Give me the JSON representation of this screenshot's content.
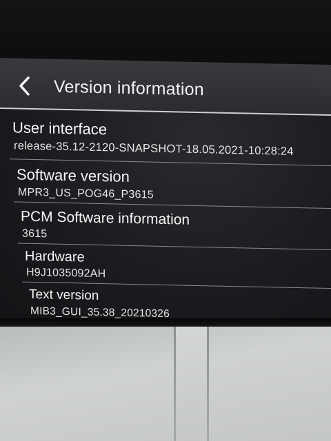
{
  "header": {
    "title": "Version information",
    "back_icon": "chevron-left-icon"
  },
  "items": [
    {
      "label": "User interface",
      "value": "release-35.12-2120-SNAPSHOT-18.05.2021-10:28:24"
    },
    {
      "label": "Software version",
      "value": "MPR3_US_POG46_P3615"
    },
    {
      "label": "PCM Software information",
      "value": "3615"
    },
    {
      "label": "Hardware",
      "value": "H9J1035092AH"
    },
    {
      "label": "Text version",
      "value": "MIB3_GUI_35.38_20210326"
    }
  ],
  "colors": {
    "screen_background": "#1c1c20",
    "header_background": "#2c2c30",
    "text": "#f2f2f2",
    "divider": "#8a8a8e",
    "trim": "#c4c7c6"
  }
}
